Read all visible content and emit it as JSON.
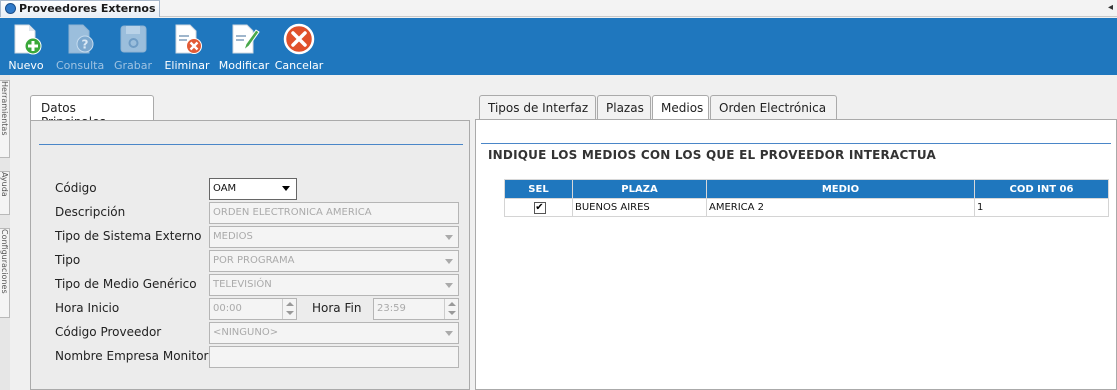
{
  "window": {
    "title": "Proveedores Externos",
    "close_glyph": "◂"
  },
  "toolbar": {
    "buttons": [
      {
        "label": "Nuevo",
        "icon": "new-document-plus-icon",
        "enabled": true
      },
      {
        "label": "Consulta",
        "icon": "document-query-icon",
        "enabled": false
      },
      {
        "label": "Grabar",
        "icon": "save-disk-icon",
        "enabled": false
      },
      {
        "label": "Eliminar",
        "icon": "delete-document-icon",
        "enabled": true
      },
      {
        "label": "Modificar",
        "icon": "edit-pencil-icon",
        "enabled": true
      },
      {
        "label": "Cancelar",
        "icon": "cancel-x-icon",
        "enabled": true
      }
    ]
  },
  "side_tabs": [
    "Herramientas",
    "Ayuda",
    "Configuraciones"
  ],
  "left": {
    "tab_label": "Datos Principales",
    "fields": {
      "codigo": {
        "label": "Código",
        "value": "OAM"
      },
      "descripcion": {
        "label": "Descripción",
        "value": "ORDEN ELECTRONICA AMERICA"
      },
      "tipo_sistema": {
        "label": "Tipo de Sistema Externo",
        "value": "MEDIOS"
      },
      "tipo": {
        "label": "Tipo",
        "value": "POR PROGRAMA"
      },
      "tipo_medio": {
        "label": "Tipo de Medio Genérico",
        "value": "TELEVISIÓN"
      },
      "hora_inicio": {
        "label": "Hora Inicio",
        "value": "00:00"
      },
      "hora_fin": {
        "label": "Hora Fin",
        "value": "23:59"
      },
      "codigo_proveedor": {
        "label": "Código Proveedor",
        "value": "<NINGUNO>"
      },
      "nombre_empresa": {
        "label": "Nombre Empresa Monitor",
        "value": ""
      }
    }
  },
  "right": {
    "tabs": [
      "Tipos de Interfaz",
      "Plazas",
      "Medios",
      "Orden Electrónica"
    ],
    "selected_tab": "Medios",
    "heading": "INDIQUE LOS MEDIOS CON LOS QUE EL PROVEEDOR INTERACTUA",
    "table": {
      "columns": [
        "SEL",
        "PLAZA",
        "MEDIO",
        "COD INT 06"
      ],
      "rows": [
        {
          "sel": "✔",
          "plaza": "BUENOS AIRES",
          "medio": "AMERICA 2",
          "cod": "1"
        }
      ]
    }
  },
  "colors": {
    "toolbar": "#1f77be",
    "grid_header": "#1f77be",
    "accent_line": "#4a86c8"
  }
}
